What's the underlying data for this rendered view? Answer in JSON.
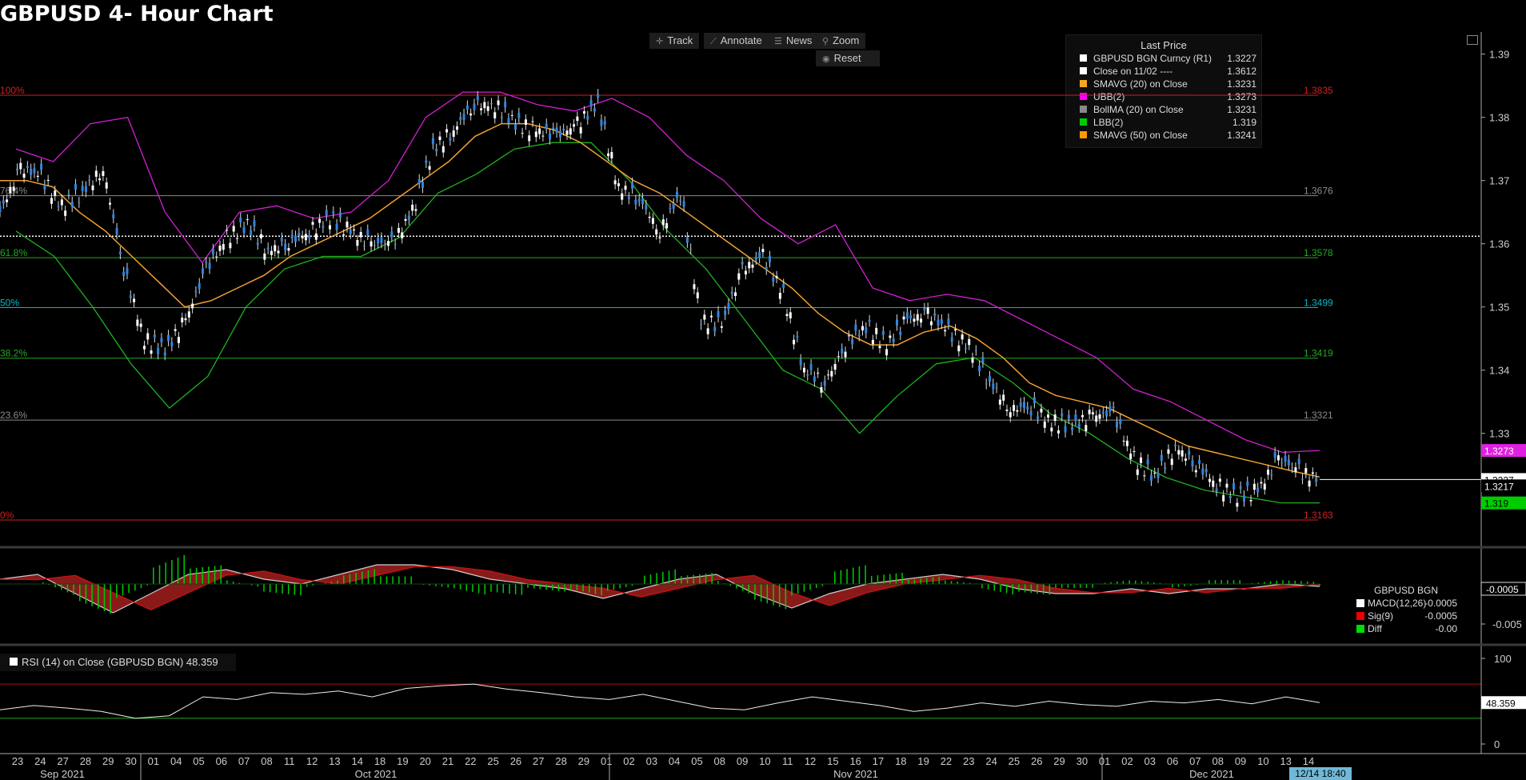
{
  "title": "GBPUSD 4- Hour Chart",
  "toolbar": {
    "track": "Track",
    "annotate": "Annotate",
    "news": "News",
    "zoom": "Zoom",
    "reset": "Reset"
  },
  "legend": {
    "title": "Last Price",
    "rows": [
      {
        "name": "GBPUSD BGN Curncy  (R1)",
        "value": "1.3227",
        "color": "#ffffff"
      },
      {
        "name": "Close on 11/02 ----",
        "value": "1.3612",
        "color": "#ffffff"
      },
      {
        "name": "SMAVG (20)  on Close",
        "value": "1.3231",
        "color": "#f5a623"
      },
      {
        "name": "UBB(2)",
        "value": "1.3273",
        "color": "#ff00ff"
      },
      {
        "name": "BollMA (20)  on Close",
        "value": "1.3231",
        "color": "#888888"
      },
      {
        "name": "LBB(2)",
        "value": "1.319",
        "color": "#00cc00"
      },
      {
        "name": "SMAVG (50)  on Close",
        "value": "1.3241",
        "color": "#ff9900"
      }
    ]
  },
  "macd_legend": {
    "title": "GBPUSD BGN",
    "rows": [
      {
        "name": "MACD(12,26)",
        "value": "-0.0005",
        "color": "#ffffff"
      },
      {
        "name": "Sig(9)",
        "value": "-0.0005",
        "color": "#ee0000"
      },
      {
        "name": "Diff",
        "value": "-0.00",
        "color": "#00dd00"
      }
    ]
  },
  "rsi_legend": "RSI (14)  on Close (GBPUSD BGN) 48.359",
  "timestamp": "12/14 18:40",
  "chart_data": [
    {
      "type": "line",
      "panel": "price",
      "y_ticks": [
        "1.39",
        "1.38",
        "1.37",
        "1.36",
        "1.35",
        "1.34",
        "1.33"
      ],
      "ylim": [
        1.3125,
        1.3935
      ],
      "fib_levels": [
        {
          "label": "100%",
          "value": 1.3835,
          "value_label": "1.3835",
          "color": "#d02020"
        },
        {
          "label": "76.4%",
          "value": 1.3676,
          "value_label": "1.3676",
          "color": "#8a8a8a"
        },
        {
          "label": "61.8%",
          "value": 1.3578,
          "value_label": "1.3578",
          "color": "#22aa22"
        },
        {
          "label": "50%",
          "value": 1.3499,
          "value_label": "1.3499",
          "color": "#00b8c8"
        },
        {
          "label": "38.2%",
          "value": 1.3419,
          "value_label": "1.3419",
          "color": "#22aa22"
        },
        {
          "label": "23.6%",
          "value": 1.3321,
          "value_label": "1.3321",
          "color": "#8a8a8a"
        },
        {
          "label": "0%",
          "value": 1.3163,
          "value_label": "1.3163",
          "color": "#d02020"
        }
      ],
      "reference_line": {
        "name": "Close on 11/02",
        "value": 1.3612
      },
      "price_tags": [
        {
          "text": "1.3273",
          "value": 1.3273,
          "bg": "#e020e0",
          "fg": "#ffffff"
        },
        {
          "text": "1.3227",
          "value": 1.3227,
          "bg": "#ffffff",
          "fg": "#000000"
        },
        {
          "text": "1.3217",
          "value": 1.3217,
          "bg": "#000000",
          "fg": "#ffffff"
        },
        {
          "text": "1.319",
          "value": 1.319,
          "bg": "#00cc00",
          "fg": "#000000"
        }
      ],
      "series": [
        {
          "name": "GBPUSD BGN Curncy",
          "color": "#3a8ee6",
          "values": [
            1.365,
            1.372,
            1.3705,
            1.366,
            1.368,
            1.372,
            1.356,
            1.345,
            1.343,
            1.348,
            1.356,
            1.361,
            1.363,
            1.359,
            1.36,
            1.362,
            1.364,
            1.362,
            1.36,
            1.36,
            1.365,
            1.375,
            1.378,
            1.382,
            1.382,
            1.379,
            1.378,
            1.377,
            1.379,
            1.382,
            1.369,
            1.367,
            1.362,
            1.368,
            1.348,
            1.347,
            1.356,
            1.358,
            1.352,
            1.34,
            1.338,
            1.344,
            1.347,
            1.344,
            1.348,
            1.349,
            1.346,
            1.344,
            1.338,
            1.334,
            1.334,
            1.332,
            1.331,
            1.333,
            1.333,
            1.326,
            1.323,
            1.328,
            1.325,
            1.322,
            1.32,
            1.321,
            1.326,
            1.324,
            1.3227
          ]
        },
        {
          "name": "SMAVG (20) on Close",
          "color": "#f0a030",
          "values": [
            1.37,
            1.37,
            1.369,
            1.365,
            1.362,
            1.358,
            1.354,
            1.35,
            1.351,
            1.353,
            1.355,
            1.358,
            1.36,
            1.362,
            1.364,
            1.367,
            1.37,
            1.373,
            1.377,
            1.379,
            1.379,
            1.378,
            1.376,
            1.373,
            1.37,
            1.368,
            1.365,
            1.362,
            1.359,
            1.356,
            1.353,
            1.349,
            1.346,
            1.344,
            1.344,
            1.346,
            1.347,
            1.345,
            1.342,
            1.338,
            1.336,
            1.335,
            1.334,
            1.332,
            1.33,
            1.328,
            1.327,
            1.326,
            1.325,
            1.324,
            1.3231
          ]
        },
        {
          "name": "UBB(2)",
          "color": "#d020d0",
          "values": [
            1.375,
            1.373,
            1.379,
            1.38,
            1.365,
            1.357,
            1.365,
            1.366,
            1.364,
            1.365,
            1.37,
            1.38,
            1.384,
            1.384,
            1.382,
            1.381,
            1.383,
            1.38,
            1.374,
            1.37,
            1.364,
            1.36,
            1.363,
            1.353,
            1.351,
            1.352,
            1.351,
            1.348,
            1.345,
            1.342,
            1.337,
            1.335,
            1.332,
            1.329,
            1.327,
            1.3273
          ]
        },
        {
          "name": "LBB(2)",
          "color": "#20b020",
          "values": [
            1.362,
            1.358,
            1.35,
            1.341,
            1.334,
            1.339,
            1.35,
            1.356,
            1.358,
            1.358,
            1.361,
            1.368,
            1.371,
            1.375,
            1.376,
            1.376,
            1.37,
            1.362,
            1.356,
            1.348,
            1.34,
            1.337,
            1.33,
            1.336,
            1.341,
            1.342,
            1.338,
            1.333,
            1.33,
            1.326,
            1.323,
            1.321,
            1.32,
            1.319,
            1.319
          ]
        }
      ]
    },
    {
      "type": "area",
      "panel": "macd",
      "y_ticks": [
        "-0.0005",
        "-0.005"
      ],
      "series": [
        {
          "name": "MACD(12,26)",
          "color": "#cccccc"
        },
        {
          "name": "Sig(9)",
          "color": "#cc1111"
        },
        {
          "name": "Diff",
          "color": "#00cc00"
        }
      ],
      "value_tag": "-0.0005",
      "values": [
        0.001,
        0.002,
        -0.002,
        -0.006,
        -0.002,
        0.002,
        0.003,
        0.001,
        0.0,
        0.002,
        0.004,
        0.004,
        0.003,
        0.001,
        0.0,
        -0.001,
        -0.003,
        -0.001,
        0.001,
        0.002,
        -0.002,
        -0.005,
        -0.002,
        0.0,
        0.001,
        0.002,
        0.001,
        -0.001,
        -0.002,
        -0.002,
        -0.001,
        -0.002,
        -0.001,
        -0.001,
        0.0,
        -0.0005
      ]
    },
    {
      "type": "line",
      "panel": "rsi",
      "y_ticks": [
        "100",
        "0"
      ],
      "ylim": [
        0,
        100
      ],
      "reference_lines": [
        70,
        30
      ],
      "value_tag": "48.359",
      "values": [
        40,
        45,
        42,
        38,
        30,
        33,
        55,
        52,
        60,
        58,
        62,
        55,
        65,
        68,
        70,
        64,
        60,
        55,
        52,
        58,
        50,
        42,
        40,
        48,
        55,
        50,
        45,
        38,
        42,
        48,
        44,
        50,
        46,
        44,
        50,
        48,
        52,
        47,
        55,
        48.359
      ]
    }
  ],
  "x_axis": {
    "ticks": [
      "23",
      "24",
      "27",
      "28",
      "29",
      "30",
      "01",
      "04",
      "05",
      "06",
      "07",
      "08",
      "11",
      "12",
      "13",
      "14",
      "18",
      "19",
      "20",
      "21",
      "22",
      "25",
      "26",
      "27",
      "28",
      "29",
      "01",
      "02",
      "03",
      "04",
      "05",
      "08",
      "09",
      "10",
      "11",
      "12",
      "15",
      "16",
      "17",
      "18",
      "19",
      "22",
      "23",
      "24",
      "25",
      "26",
      "29",
      "30",
      "01",
      "02",
      "03",
      "06",
      "07",
      "08",
      "09",
      "10",
      "13",
      "14"
    ],
    "months": [
      "Sep 2021",
      "Oct 2021",
      "Nov 2021",
      "Dec 2021"
    ]
  }
}
